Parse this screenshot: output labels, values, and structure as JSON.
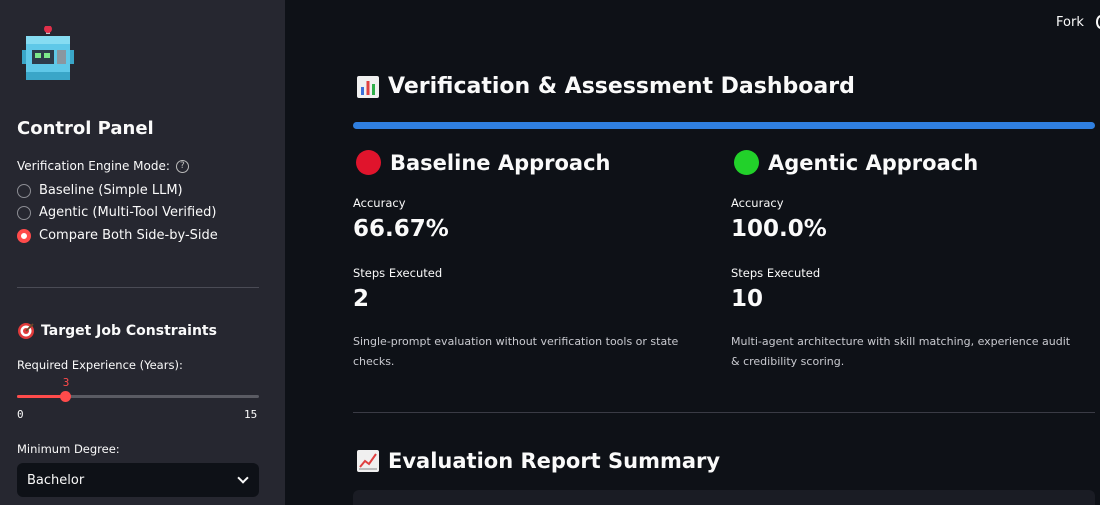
{
  "header": {
    "fork_label": "Fork"
  },
  "sidebar": {
    "title": "Control Panel",
    "mode_label": "Verification Engine Mode:",
    "help_symbol": "?",
    "modes": [
      {
        "label": "Baseline (Simple LLM)",
        "selected": false
      },
      {
        "label": "Agentic (Multi-Tool Verified)",
        "selected": false
      },
      {
        "label": "Compare Both Side-by-Side",
        "selected": true
      }
    ],
    "constraints_title": "Target Job Constraints",
    "experience_label": "Required Experience (Years):",
    "experience_value": "3",
    "experience_min": "0",
    "experience_max": "15",
    "degree_label": "Minimum Degree:",
    "degree_value": "Bachelor"
  },
  "main": {
    "dashboard_title": "Verification & Assessment Dashboard",
    "baseline": {
      "title": "Baseline Approach",
      "accuracy_label": "Accuracy",
      "accuracy_value": "66.67%",
      "steps_label": "Steps Executed",
      "steps_value": "2",
      "description": "Single-prompt evaluation without verification tools or state checks."
    },
    "agentic": {
      "title": "Agentic Approach",
      "accuracy_label": "Accuracy",
      "accuracy_value": "100.0%",
      "steps_label": "Steps Executed",
      "steps_value": "10",
      "description": "Multi-agent architecture with skill matching, experience audit & credibility scoring."
    },
    "report_title": "Evaluation Report Summary"
  },
  "colors": {
    "accent": "#ff4b4b",
    "progress_blue": "#2f7fe0",
    "baseline_circle": "#e0142c",
    "agentic_circle": "#22d12a"
  }
}
